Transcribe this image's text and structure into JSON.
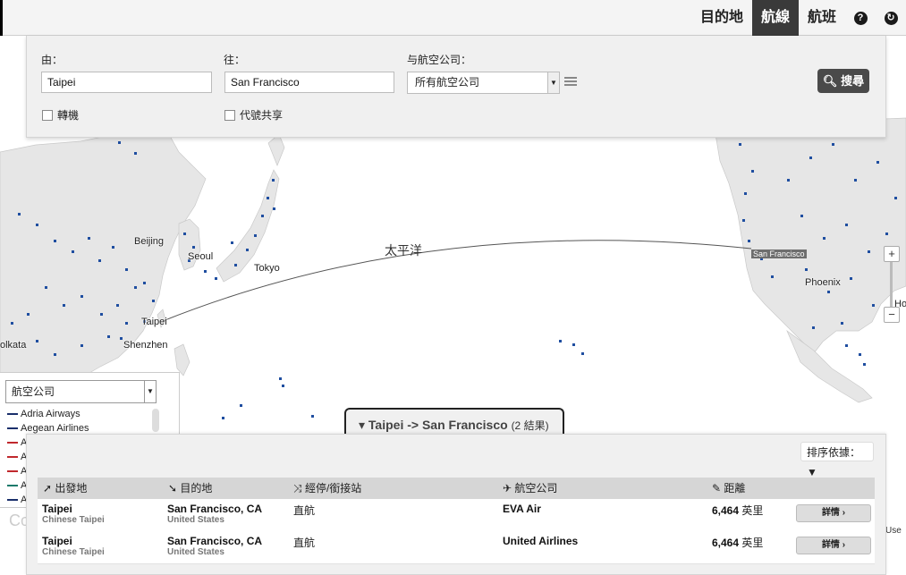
{
  "nav": {
    "items": [
      {
        "label": "目的地",
        "active": false
      },
      {
        "label": "航線",
        "active": true
      },
      {
        "label": "航班",
        "active": false
      }
    ],
    "help_icon": "?",
    "refresh_icon": "↻"
  },
  "search": {
    "from_label": "由：",
    "from_value": "Taipei",
    "to_label": "往：",
    "to_value": "San Francisco",
    "airline_label": "与航空公司：",
    "airline_value": "所有航空公司",
    "search_button": "搜尋",
    "transfer_label": "轉機",
    "codeshare_label": "代號共享"
  },
  "map": {
    "ocean_label": "太平洋",
    "cities": {
      "beijing": "Beijing",
      "seoul": "Seoul",
      "tokyo": "Tokyo",
      "taipei": "Taipei",
      "shenzhen": "Shenzhen",
      "kolkata": "olkata",
      "san_francisco": "San Francisco",
      "phoenix": "Phoenix",
      "houston": "Hou"
    },
    "zoom_in": "+",
    "zoom_out": "−",
    "footer_left": "Co",
    "footer_right": "Use"
  },
  "airline_filter": {
    "select_label": "航空公司",
    "items": [
      {
        "name": "Adria Airways",
        "color": "#1a2f6b"
      },
      {
        "name": "Aegean Airlines",
        "color": "#1a2f6b"
      },
      {
        "name": "A",
        "color": "#c0282d"
      },
      {
        "name": "A",
        "color": "#c0282d"
      },
      {
        "name": "A",
        "color": "#c0282d"
      },
      {
        "name": "A",
        "color": "#1a7a6b"
      },
      {
        "name": "A",
        "color": "#1a2f6b"
      }
    ]
  },
  "results": {
    "tab_title": "Taipei -> San Francisco",
    "tab_count": "(2 結果)",
    "sort_label": "排序依據：",
    "headers": {
      "origin": "出發地",
      "destination": "目的地",
      "stops": "經停/銜接站",
      "airline": "航空公司",
      "distance": "距離"
    },
    "rows": [
      {
        "origin": "Taipei",
        "origin_sub": "Chinese Taipei",
        "destination": "San Francisco, CA",
        "destination_sub": "United States",
        "stops": "直航",
        "airline": "EVA Air",
        "distance": "6,464",
        "distance_unit": "英里",
        "detail": "詳情"
      },
      {
        "origin": "Taipei",
        "origin_sub": "Chinese Taipei",
        "destination": "San Francisco, CA",
        "destination_sub": "United States",
        "stops": "直航",
        "airline": "United Airlines",
        "distance": "6,464",
        "distance_unit": "英里",
        "detail": "詳情"
      }
    ]
  }
}
